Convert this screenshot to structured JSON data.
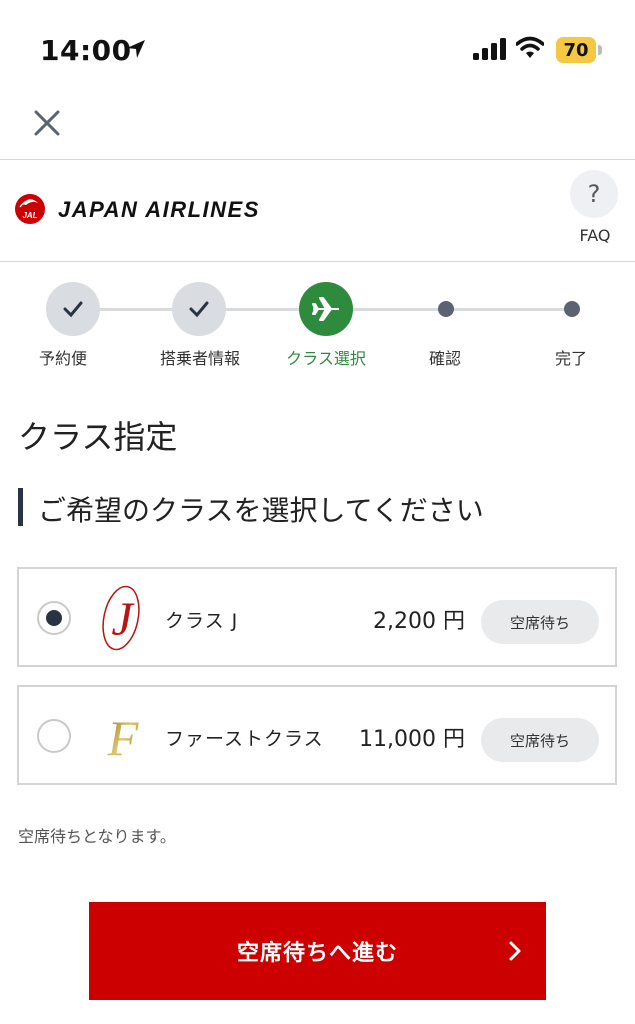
{
  "status_bar": {
    "time": "14:00",
    "battery": "70"
  },
  "header": {
    "brand": "JAPAN AIRLINES",
    "logo_text": "JAL",
    "faq_symbol": "?",
    "faq_label": "FAQ"
  },
  "stepper": {
    "steps": [
      {
        "label": "予約便",
        "state": "done"
      },
      {
        "label": "搭乗者情報",
        "state": "done"
      },
      {
        "label": "クラス選択",
        "state": "current"
      },
      {
        "label": "確認",
        "state": "pending"
      },
      {
        "label": "完了",
        "state": "pending"
      }
    ]
  },
  "page": {
    "title": "クラス指定",
    "section_title": "ご希望のクラスを選択してください",
    "note": "空席待ちとなります。"
  },
  "classes": [
    {
      "emblem": "J",
      "name": "クラス J",
      "price": "2,200 円",
      "status": "空席待ち",
      "selected": true
    },
    {
      "emblem": "F",
      "name": "ファーストクラス",
      "price": "11,000 円",
      "status": "空席待ち",
      "selected": false
    }
  ],
  "submit": {
    "label": "空席待ちへ進む"
  },
  "colors": {
    "accent_red": "#cc0000",
    "step_green": "#2e8b3d",
    "navy": "#2a3345"
  },
  "icons": {
    "close": "close-icon",
    "location": "location-arrow-icon",
    "signal": "signal-icon",
    "wifi": "wifi-icon",
    "check": "check-icon",
    "plane": "airplane-icon",
    "chevron": "chevron-right-icon"
  }
}
